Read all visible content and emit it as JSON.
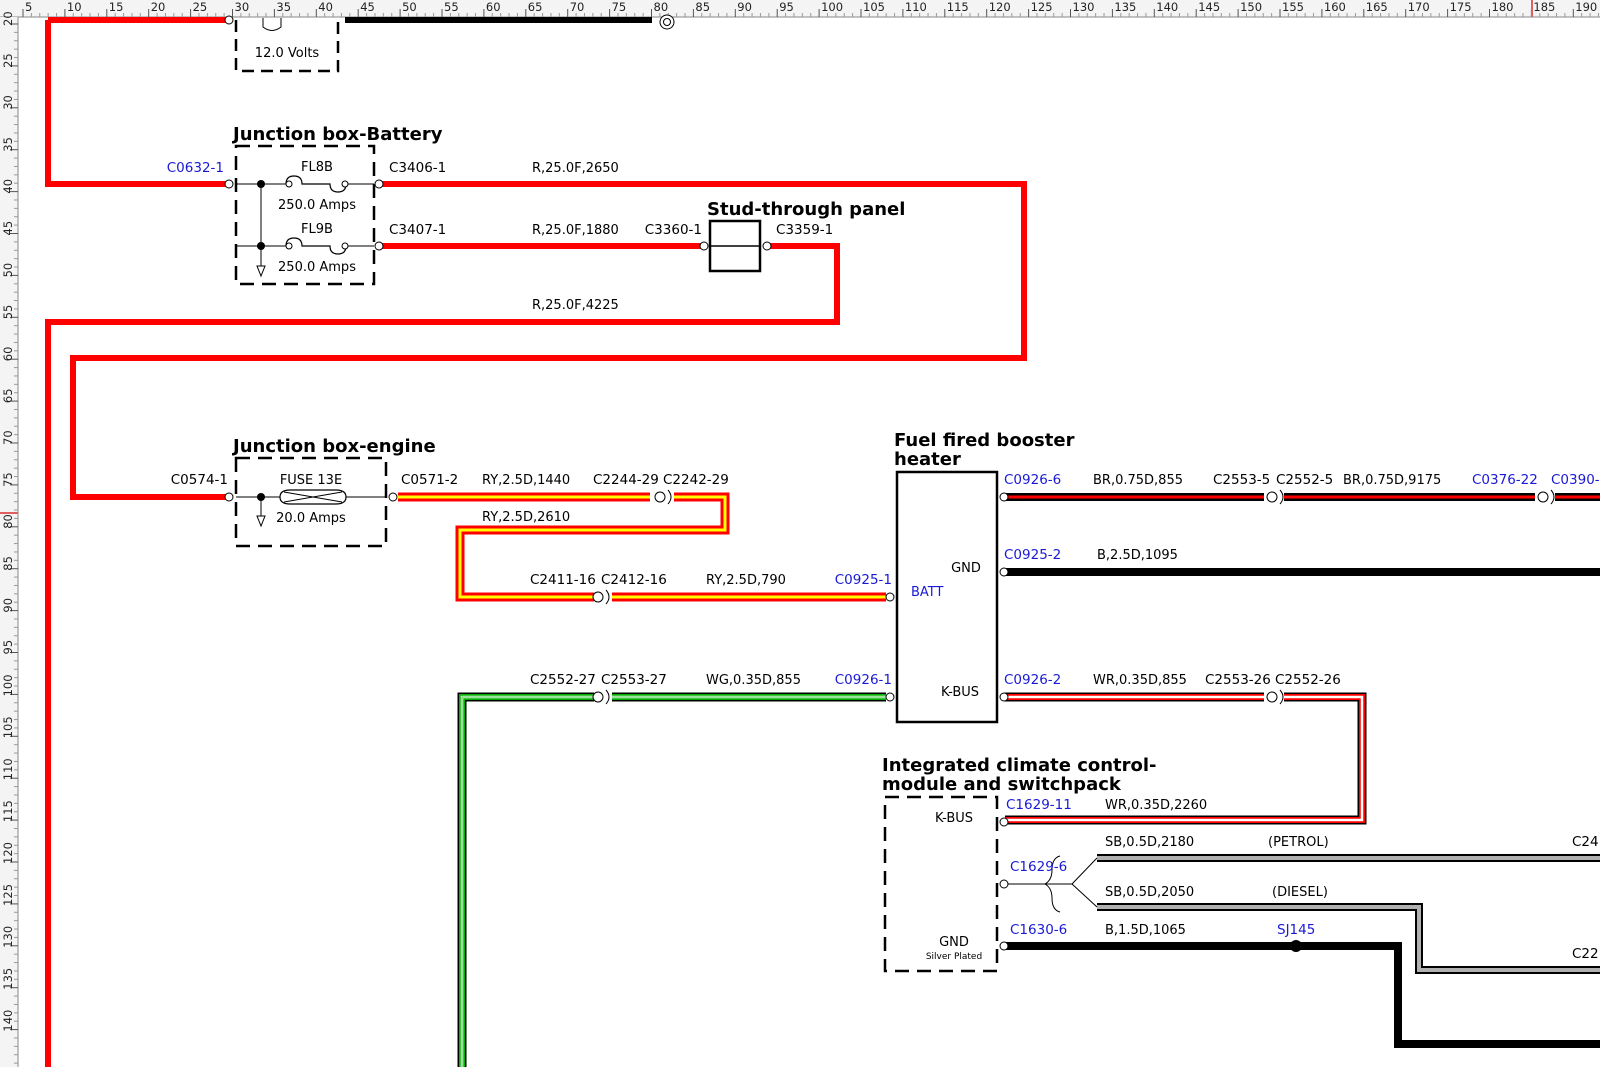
{
  "ruler": {
    "top_ticks": [
      "5",
      "10",
      "15",
      "20",
      "25",
      "30",
      "35",
      "40",
      "45",
      "50",
      "55",
      "60",
      "65",
      "70",
      "75",
      "80",
      "85",
      "90",
      "95",
      "100",
      "105",
      "110",
      "115",
      "120",
      "125",
      "130",
      "135",
      "140",
      "145",
      "150",
      "155",
      "160",
      "165",
      "170",
      "175",
      "180",
      "185",
      "190"
    ],
    "left_ticks": [
      "20",
      "25",
      "30",
      "35",
      "40",
      "45",
      "50",
      "55",
      "60",
      "65",
      "70",
      "75",
      "80",
      "85",
      "90",
      "95",
      "100",
      "105",
      "110",
      "115",
      "120",
      "125",
      "130",
      "135",
      "140"
    ]
  },
  "components": {
    "battery_volts": "12.0 Volts",
    "jb_battery": {
      "title": "Junction box-Battery",
      "fuse1": "FL8B",
      "fuse1_rating": "250.0 Amps",
      "fuse2": "FL9B",
      "fuse2_rating": "250.0 Amps"
    },
    "stud_panel": {
      "title": "Stud-through panel"
    },
    "jb_engine": {
      "title": "Junction box-engine",
      "fuse": "FUSE 13E",
      "fuse_rating": "20.0 Amps"
    },
    "heater": {
      "title_line1": "Fuel fired booster",
      "title_line2": "heater",
      "pin_gnd": "GND",
      "pin_batt": "BATT",
      "pin_kbus": "K-BUS"
    },
    "climate": {
      "title_line1": "Integrated climate control-",
      "title_line2": "module and switchpack",
      "pin_kbus": "K-BUS",
      "pin_gnd": "GND",
      "pin_gnd_sub": "Silver Plated"
    }
  },
  "connectors": {
    "c0632": "C0632-1",
    "c3406": "C3406-1",
    "c3407": "C3407-1",
    "c3360": "C3360-1",
    "c3359": "C3359-1",
    "c0574": "C0574-1",
    "c0571": "C0571-2",
    "c2244": "C2244-29",
    "c2242": "C2242-29",
    "c2411": "C2411-16",
    "c2412": "C2412-16",
    "c0925_1": "C0925-1",
    "c2552_27": "C2552-27",
    "c2553_27": "C2553-27",
    "c0926_1": "C0926-1",
    "c0926_6": "C0926-6",
    "c2553_5": "C2553-5",
    "c2552_5": "C2552-5",
    "c0376": "C0376-22",
    "c0390": "C0390-",
    "c0925_2": "C0925-2",
    "c0926_2": "C0926-2",
    "c2553_26": "C2553-26",
    "c2552_26": "C2552-26",
    "c1629_11": "C1629-11",
    "c1629_6": "C1629-6",
    "c1630_6": "C1630-6",
    "sj145": "SJ145",
    "c24": "C24",
    "c22": "C22"
  },
  "wires": {
    "w2650": "R,25.0F,2650",
    "w1880": "R,25.0F,1880",
    "w4225": "R,25.0F,4225",
    "w1440": "RY,2.5D,1440",
    "w2610": "RY,2.5D,2610",
    "w790": "RY,2.5D,790",
    "w855wg": "WG,0.35D,855",
    "w855br": "BR,0.75D,855",
    "w9175": "BR,0.75D,9175",
    "w1095": "B,2.5D,1095",
    "w855wr": "WR,0.35D,855",
    "w2260": "WR,0.35D,2260",
    "w2180": "SB,0.5D,2180",
    "petrol": "(PETROL)",
    "w2050": "SB,0.5D,2050",
    "diesel": "(DIESEL)",
    "w1065": "B,1.5D,1065"
  },
  "colors": {
    "red": "#ff0000",
    "yellow": "#ffff00",
    "green": "#00a000",
    "black": "#000000",
    "grey": "#9a9a9a",
    "blue_label": "#1a1ad6"
  }
}
